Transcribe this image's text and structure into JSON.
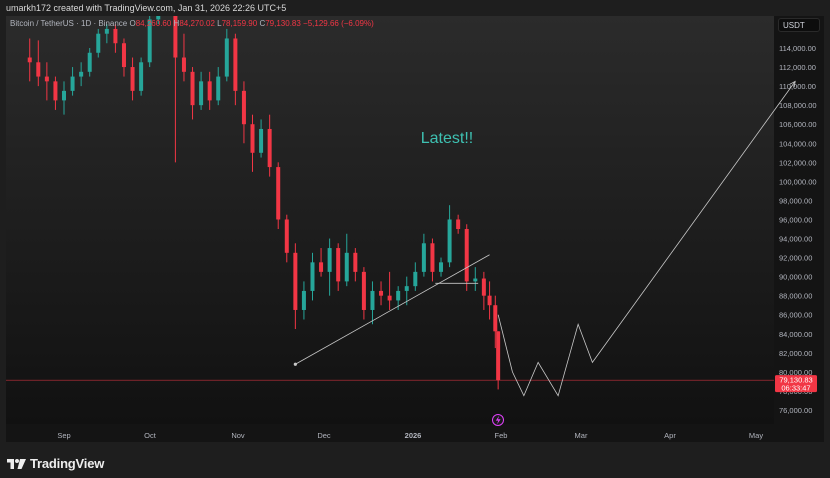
{
  "header": {
    "attribution": "umarkh172 created with TradingView.com, Jan 31, 2026 22:26 UTC+5"
  },
  "legend": {
    "symbol": "Bitcoin / TetherUS · 1D · Binance",
    "open_label": "O",
    "open": "84,260.60",
    "high_label": "H",
    "high": "84,270.02",
    "low_label": "L",
    "low": "78,159.90",
    "close_label": "C",
    "close": "79,130.83",
    "change": "−5,129.66 (−6.09%)"
  },
  "currency": "USDT",
  "annotation": "Latest!!",
  "price_badge": {
    "price": "79,130.83",
    "countdown": "06:33:47"
  },
  "footer": {
    "brand": "TradingView"
  },
  "colors": {
    "up": "#26a69a",
    "down": "#f23645",
    "text_green": "#3ec1b2",
    "line": "#c8c8c8"
  },
  "chart_data": {
    "type": "candlestick",
    "y_axis": {
      "min": 75000,
      "max": 115500,
      "ticks": [
        "114,000.00",
        "112,000.00",
        "110,000.00",
        "108,000.00",
        "106,000.00",
        "104,000.00",
        "102,000.00",
        "100,000.00",
        "98,000.00",
        "96,000.00",
        "94,000.00",
        "92,000.00",
        "90,000.00",
        "88,000.00",
        "86,000.00",
        "84,000.00",
        "82,000.00",
        "80,000.00",
        "78,000.00",
        "76,000.00"
      ]
    },
    "x_axis": {
      "labels": [
        "Sep",
        "Oct",
        "Nov",
        "Dec",
        "2026",
        "Feb",
        "Mar",
        "Apr",
        "May"
      ]
    },
    "current_price": 79130.83,
    "candles": [
      {
        "date": "2025-08-20",
        "o": 113000,
        "h": 115000,
        "l": 110500,
        "c": 112500
      },
      {
        "date": "2025-08-23",
        "o": 112500,
        "h": 114800,
        "l": 110000,
        "c": 111000
      },
      {
        "date": "2025-08-26",
        "o": 111000,
        "h": 112500,
        "l": 108500,
        "c": 110500
      },
      {
        "date": "2025-08-29",
        "o": 110500,
        "h": 111000,
        "l": 107500,
        "c": 108500
      },
      {
        "date": "2025-09-01",
        "o": 108500,
        "h": 110500,
        "l": 107000,
        "c": 109500
      },
      {
        "date": "2025-09-04",
        "o": 109500,
        "h": 112000,
        "l": 109000,
        "c": 111000
      },
      {
        "date": "2025-09-07",
        "o": 111000,
        "h": 112500,
        "l": 110000,
        "c": 111500
      },
      {
        "date": "2025-09-10",
        "o": 111500,
        "h": 114000,
        "l": 111000,
        "c": 113500
      },
      {
        "date": "2025-09-13",
        "o": 113500,
        "h": 116000,
        "l": 113000,
        "c": 115500
      },
      {
        "date": "2025-09-16",
        "o": 115500,
        "h": 116500,
        "l": 114500,
        "c": 116000
      },
      {
        "date": "2025-09-19",
        "o": 116000,
        "h": 116500,
        "l": 113500,
        "c": 114500
      },
      {
        "date": "2025-09-22",
        "o": 114500,
        "h": 115000,
        "l": 111000,
        "c": 112000
      },
      {
        "date": "2025-09-25",
        "o": 112000,
        "h": 113000,
        "l": 108500,
        "c": 109500
      },
      {
        "date": "2025-09-28",
        "o": 109500,
        "h": 113000,
        "l": 109000,
        "c": 112500
      },
      {
        "date": "2025-10-01",
        "o": 112500,
        "h": 118000,
        "l": 112000,
        "c": 117000
      },
      {
        "date": "2025-10-04",
        "o": 117000,
        "h": 124000,
        "l": 116500,
        "c": 122500
      },
      {
        "date": "2025-10-07",
        "o": 122500,
        "h": 124500,
        "l": 120000,
        "c": 121500
      },
      {
        "date": "2025-10-10",
        "o": 121500,
        "h": 122000,
        "l": 102000,
        "c": 113000
      },
      {
        "date": "2025-10-13",
        "o": 113000,
        "h": 115500,
        "l": 110500,
        "c": 111500
      },
      {
        "date": "2025-10-16",
        "o": 111500,
        "h": 112000,
        "l": 106500,
        "c": 108000
      },
      {
        "date": "2025-10-19",
        "o": 108000,
        "h": 111500,
        "l": 107500,
        "c": 110500
      },
      {
        "date": "2025-10-22",
        "o": 110500,
        "h": 111500,
        "l": 107500,
        "c": 108500
      },
      {
        "date": "2025-10-25",
        "o": 108500,
        "h": 112000,
        "l": 108000,
        "c": 111000
      },
      {
        "date": "2025-10-28",
        "o": 111000,
        "h": 116000,
        "l": 110500,
        "c": 115000
      },
      {
        "date": "2025-10-31",
        "o": 115000,
        "h": 115500,
        "l": 108000,
        "c": 109500
      },
      {
        "date": "2025-11-03",
        "o": 109500,
        "h": 110500,
        "l": 104000,
        "c": 106000
      },
      {
        "date": "2025-11-06",
        "o": 106000,
        "h": 107000,
        "l": 101000,
        "c": 103000
      },
      {
        "date": "2025-11-09",
        "o": 103000,
        "h": 106500,
        "l": 102500,
        "c": 105500
      },
      {
        "date": "2025-11-12",
        "o": 105500,
        "h": 107000,
        "l": 100500,
        "c": 101500
      },
      {
        "date": "2025-11-15",
        "o": 101500,
        "h": 102000,
        "l": 95000,
        "c": 96000
      },
      {
        "date": "2025-11-18",
        "o": 96000,
        "h": 96500,
        "l": 91500,
        "c": 92500
      },
      {
        "date": "2025-11-21",
        "o": 92500,
        "h": 93500,
        "l": 84500,
        "c": 86500
      },
      {
        "date": "2025-11-24",
        "o": 86500,
        "h": 89500,
        "l": 85500,
        "c": 88500
      },
      {
        "date": "2025-11-27",
        "o": 88500,
        "h": 92500,
        "l": 87500,
        "c": 91500
      },
      {
        "date": "2025-11-30",
        "o": 91500,
        "h": 93000,
        "l": 90000,
        "c": 90500
      },
      {
        "date": "2025-12-03",
        "o": 90500,
        "h": 94000,
        "l": 88000,
        "c": 93000
      },
      {
        "date": "2025-12-06",
        "o": 93000,
        "h": 93500,
        "l": 88500,
        "c": 89500
      },
      {
        "date": "2025-12-09",
        "o": 89500,
        "h": 94500,
        "l": 89000,
        "c": 92500
      },
      {
        "date": "2025-12-12",
        "o": 92500,
        "h": 93000,
        "l": 89500,
        "c": 90500
      },
      {
        "date": "2025-12-15",
        "o": 90500,
        "h": 91000,
        "l": 85500,
        "c": 86500
      },
      {
        "date": "2025-12-18",
        "o": 86500,
        "h": 89500,
        "l": 85000,
        "c": 88500
      },
      {
        "date": "2025-12-21",
        "o": 88500,
        "h": 89500,
        "l": 87000,
        "c": 88000
      },
      {
        "date": "2025-12-24",
        "o": 88000,
        "h": 90500,
        "l": 86500,
        "c": 87500
      },
      {
        "date": "2025-12-27",
        "o": 87500,
        "h": 89000,
        "l": 86500,
        "c": 88500
      },
      {
        "date": "2025-12-30",
        "o": 88500,
        "h": 90000,
        "l": 87000,
        "c": 89000
      },
      {
        "date": "2026-01-02",
        "o": 89000,
        "h": 91500,
        "l": 88500,
        "c": 90500
      },
      {
        "date": "2026-01-05",
        "o": 90500,
        "h": 94500,
        "l": 90000,
        "c": 93500
      },
      {
        "date": "2026-01-08",
        "o": 93500,
        "h": 94000,
        "l": 89500,
        "c": 90500
      },
      {
        "date": "2026-01-11",
        "o": 90500,
        "h": 92000,
        "l": 90000,
        "c": 91500
      },
      {
        "date": "2026-01-14",
        "o": 91500,
        "h": 97500,
        "l": 91000,
        "c": 96000
      },
      {
        "date": "2026-01-17",
        "o": 96000,
        "h": 96500,
        "l": 94500,
        "c": 95000
      },
      {
        "date": "2026-01-20",
        "o": 95000,
        "h": 95500,
        "l": 88500,
        "c": 89500
      },
      {
        "date": "2026-01-23",
        "o": 89500,
        "h": 91000,
        "l": 88500,
        "c": 89800
      },
      {
        "date": "2026-01-26",
        "o": 89800,
        "h": 90500,
        "l": 86500,
        "c": 88000
      },
      {
        "date": "2026-01-28",
        "o": 88000,
        "h": 89500,
        "l": 85500,
        "c": 87000
      },
      {
        "date": "2026-01-30",
        "o": 87000,
        "h": 88000,
        "l": 82500,
        "c": 84260
      },
      {
        "date": "2026-01-31",
        "o": 84260,
        "h": 84270,
        "l": 78160,
        "c": 79131
      }
    ],
    "trendline": [
      {
        "date": "2025-11-21",
        "price": 80800
      },
      {
        "date": "2026-01-28",
        "price": 92300
      }
    ],
    "flat_line": [
      {
        "date": "2026-01-09",
        "price": 89300
      },
      {
        "date": "2026-01-24",
        "price": 89300
      }
    ],
    "projection": [
      {
        "date": "2026-01-31",
        "price": 86000
      },
      {
        "date": "2026-02-05",
        "price": 80000
      },
      {
        "date": "2026-02-09",
        "price": 77500
      },
      {
        "date": "2026-02-14",
        "price": 81000
      },
      {
        "date": "2026-02-21",
        "price": 77500
      },
      {
        "date": "2026-02-28",
        "price": 85000
      },
      {
        "date": "2026-03-05",
        "price": 81000
      },
      {
        "date": "2026-05-15",
        "price": 110500
      }
    ]
  }
}
